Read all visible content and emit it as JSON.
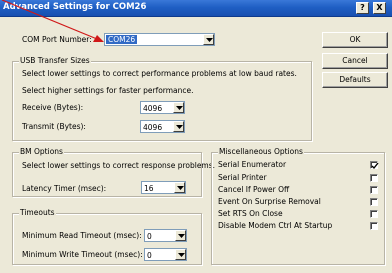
{
  "window": {
    "title": "Advanced Settings for COM26",
    "help_button": "?",
    "close_button": "X"
  },
  "com_port": {
    "label": "COM Port Number:",
    "value": "COM26"
  },
  "buttons": {
    "ok": "OK",
    "cancel": "Cancel",
    "defaults": "Defaults"
  },
  "usb_transfer": {
    "group_title": "USB Transfer Sizes",
    "hint1": "Select lower settings to correct performance problems at low baud rates.",
    "hint2": "Select higher settings for faster performance.",
    "receive_label": "Receive (Bytes):",
    "receive_value": "4096",
    "transmit_label": "Transmit (Bytes):",
    "transmit_value": "4096"
  },
  "bm_options": {
    "group_title": "BM Options",
    "hint": "Select lower settings to correct response problems.",
    "latency_label": "Latency Timer (msec):",
    "latency_value": "16"
  },
  "timeouts": {
    "group_title": "Timeouts",
    "read_label": "Minimum Read Timeout (msec):",
    "read_value": "0",
    "write_label": "Minimum Write Timeout (msec):",
    "write_value": "0"
  },
  "misc": {
    "group_title": "Miscellaneous Options",
    "items": [
      {
        "label": "Serial Enumerator",
        "checked": true
      },
      {
        "label": "Serial Printer",
        "checked": false
      },
      {
        "label": "Cancel If Power Off",
        "checked": false
      },
      {
        "label": "Event On Surprise Removal",
        "checked": false
      },
      {
        "label": "Set RTS On Close",
        "checked": false
      },
      {
        "label": "Disable Modem Ctrl At Startup",
        "checked": false
      }
    ]
  },
  "colors": {
    "title_bar": "#1f5fc4",
    "selection": "#316ac5",
    "dialog_bg": "#ece9d8",
    "annotation_arrow": "#d01818"
  },
  "icons": {
    "dropdown": "chevron-down-icon",
    "check": "checkmark-icon"
  }
}
